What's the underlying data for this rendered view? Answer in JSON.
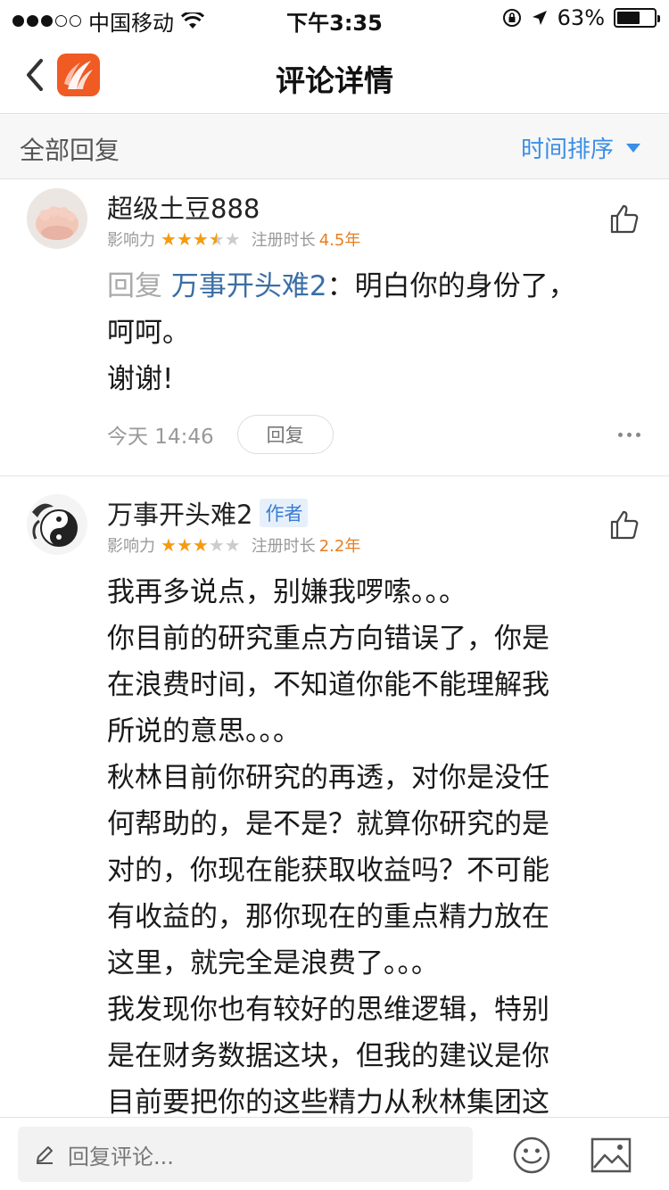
{
  "status_bar": {
    "carrier": "中国移动",
    "time": "下午3:35",
    "battery_text": "63%",
    "battery_level": 0.63
  },
  "nav": {
    "title": "评论详情",
    "icons": [
      "back-chevron-icon",
      "app-logo-icon"
    ]
  },
  "section": {
    "title": "全部回复",
    "sort_label": "时间排序"
  },
  "comments": [
    {
      "username": "超级土豆888",
      "is_author": false,
      "influence_label": "影响力",
      "stars": 3.5,
      "reg_label": "注册时长",
      "reg_value": "4.5年",
      "reply_prefix": "回复",
      "reply_target": "万事开头难2",
      "reply_sep": "：",
      "lines": [
        "明白你的身份了，",
        "呵呵。",
        "谢谢!"
      ],
      "timestamp": "今天 14:46",
      "reply_button": "回复"
    },
    {
      "username": "万事开头难2",
      "is_author": true,
      "author_badge": "作者",
      "influence_label": "影响力",
      "stars": 3,
      "reg_label": "注册时长",
      "reg_value": "2.2年",
      "lines": [
        "我再多说点，别嫌我啰嗦。。。",
        "你目前的研究重点方向错误了，你是",
        "在浪费时间，不知道你能不能理解我",
        "所说的意思。。。",
        "秋林目前你研究的再透，对你是没任",
        "何帮助的，是不是？就算你研究的是",
        "对的，你现在能获取收益吗？不可能",
        "有收益的，那你现在的重点精力放在",
        "这里，就完全是浪费了。。。",
        "我发现你也有较好的思维逻辑，特别",
        "是在财务数据这块，但我的建议是你",
        "目前要把你的这些精力从秋林集团这"
      ]
    }
  ],
  "bottom_bar": {
    "placeholder": "回复评论...",
    "icons": [
      "edit-icon",
      "emoji-icon",
      "image-icon"
    ]
  },
  "colors": {
    "accent_blue": "#3a8ee6",
    "star_orange": "#f39c12",
    "value_orange": "#e67e22",
    "logo_orange": "#f05a23"
  }
}
